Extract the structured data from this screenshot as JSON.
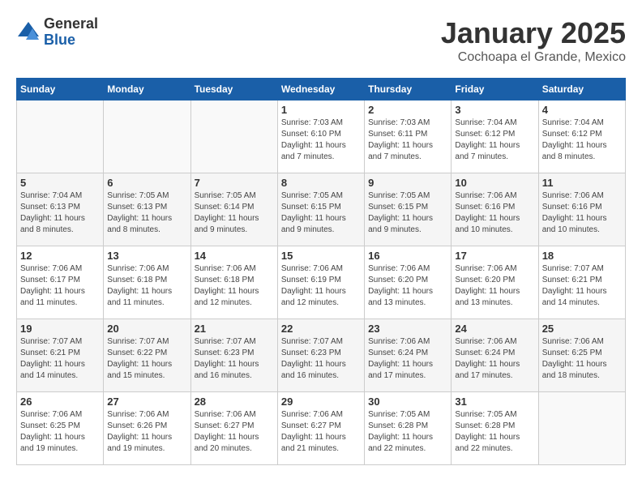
{
  "logo": {
    "general": "General",
    "blue": "Blue"
  },
  "title": "January 2025",
  "location": "Cochoapa el Grande, Mexico",
  "weekdays": [
    "Sunday",
    "Monday",
    "Tuesday",
    "Wednesday",
    "Thursday",
    "Friday",
    "Saturday"
  ],
  "weeks": [
    [
      {
        "day": "",
        "info": ""
      },
      {
        "day": "",
        "info": ""
      },
      {
        "day": "",
        "info": ""
      },
      {
        "day": "1",
        "info": "Sunrise: 7:03 AM\nSunset: 6:10 PM\nDaylight: 11 hours\nand 7 minutes."
      },
      {
        "day": "2",
        "info": "Sunrise: 7:03 AM\nSunset: 6:11 PM\nDaylight: 11 hours\nand 7 minutes."
      },
      {
        "day": "3",
        "info": "Sunrise: 7:04 AM\nSunset: 6:12 PM\nDaylight: 11 hours\nand 7 minutes."
      },
      {
        "day": "4",
        "info": "Sunrise: 7:04 AM\nSunset: 6:12 PM\nDaylight: 11 hours\nand 8 minutes."
      }
    ],
    [
      {
        "day": "5",
        "info": "Sunrise: 7:04 AM\nSunset: 6:13 PM\nDaylight: 11 hours\nand 8 minutes."
      },
      {
        "day": "6",
        "info": "Sunrise: 7:05 AM\nSunset: 6:13 PM\nDaylight: 11 hours\nand 8 minutes."
      },
      {
        "day": "7",
        "info": "Sunrise: 7:05 AM\nSunset: 6:14 PM\nDaylight: 11 hours\nand 9 minutes."
      },
      {
        "day": "8",
        "info": "Sunrise: 7:05 AM\nSunset: 6:15 PM\nDaylight: 11 hours\nand 9 minutes."
      },
      {
        "day": "9",
        "info": "Sunrise: 7:05 AM\nSunset: 6:15 PM\nDaylight: 11 hours\nand 9 minutes."
      },
      {
        "day": "10",
        "info": "Sunrise: 7:06 AM\nSunset: 6:16 PM\nDaylight: 11 hours\nand 10 minutes."
      },
      {
        "day": "11",
        "info": "Sunrise: 7:06 AM\nSunset: 6:16 PM\nDaylight: 11 hours\nand 10 minutes."
      }
    ],
    [
      {
        "day": "12",
        "info": "Sunrise: 7:06 AM\nSunset: 6:17 PM\nDaylight: 11 hours\nand 11 minutes."
      },
      {
        "day": "13",
        "info": "Sunrise: 7:06 AM\nSunset: 6:18 PM\nDaylight: 11 hours\nand 11 minutes."
      },
      {
        "day": "14",
        "info": "Sunrise: 7:06 AM\nSunset: 6:18 PM\nDaylight: 11 hours\nand 12 minutes."
      },
      {
        "day": "15",
        "info": "Sunrise: 7:06 AM\nSunset: 6:19 PM\nDaylight: 11 hours\nand 12 minutes."
      },
      {
        "day": "16",
        "info": "Sunrise: 7:06 AM\nSunset: 6:20 PM\nDaylight: 11 hours\nand 13 minutes."
      },
      {
        "day": "17",
        "info": "Sunrise: 7:06 AM\nSunset: 6:20 PM\nDaylight: 11 hours\nand 13 minutes."
      },
      {
        "day": "18",
        "info": "Sunrise: 7:07 AM\nSunset: 6:21 PM\nDaylight: 11 hours\nand 14 minutes."
      }
    ],
    [
      {
        "day": "19",
        "info": "Sunrise: 7:07 AM\nSunset: 6:21 PM\nDaylight: 11 hours\nand 14 minutes."
      },
      {
        "day": "20",
        "info": "Sunrise: 7:07 AM\nSunset: 6:22 PM\nDaylight: 11 hours\nand 15 minutes."
      },
      {
        "day": "21",
        "info": "Sunrise: 7:07 AM\nSunset: 6:23 PM\nDaylight: 11 hours\nand 16 minutes."
      },
      {
        "day": "22",
        "info": "Sunrise: 7:07 AM\nSunset: 6:23 PM\nDaylight: 11 hours\nand 16 minutes."
      },
      {
        "day": "23",
        "info": "Sunrise: 7:06 AM\nSunset: 6:24 PM\nDaylight: 11 hours\nand 17 minutes."
      },
      {
        "day": "24",
        "info": "Sunrise: 7:06 AM\nSunset: 6:24 PM\nDaylight: 11 hours\nand 17 minutes."
      },
      {
        "day": "25",
        "info": "Sunrise: 7:06 AM\nSunset: 6:25 PM\nDaylight: 11 hours\nand 18 minutes."
      }
    ],
    [
      {
        "day": "26",
        "info": "Sunrise: 7:06 AM\nSunset: 6:25 PM\nDaylight: 11 hours\nand 19 minutes."
      },
      {
        "day": "27",
        "info": "Sunrise: 7:06 AM\nSunset: 6:26 PM\nDaylight: 11 hours\nand 19 minutes."
      },
      {
        "day": "28",
        "info": "Sunrise: 7:06 AM\nSunset: 6:27 PM\nDaylight: 11 hours\nand 20 minutes."
      },
      {
        "day": "29",
        "info": "Sunrise: 7:06 AM\nSunset: 6:27 PM\nDaylight: 11 hours\nand 21 minutes."
      },
      {
        "day": "30",
        "info": "Sunrise: 7:05 AM\nSunset: 6:28 PM\nDaylight: 11 hours\nand 22 minutes."
      },
      {
        "day": "31",
        "info": "Sunrise: 7:05 AM\nSunset: 6:28 PM\nDaylight: 11 hours\nand 22 minutes."
      },
      {
        "day": "",
        "info": ""
      }
    ]
  ]
}
